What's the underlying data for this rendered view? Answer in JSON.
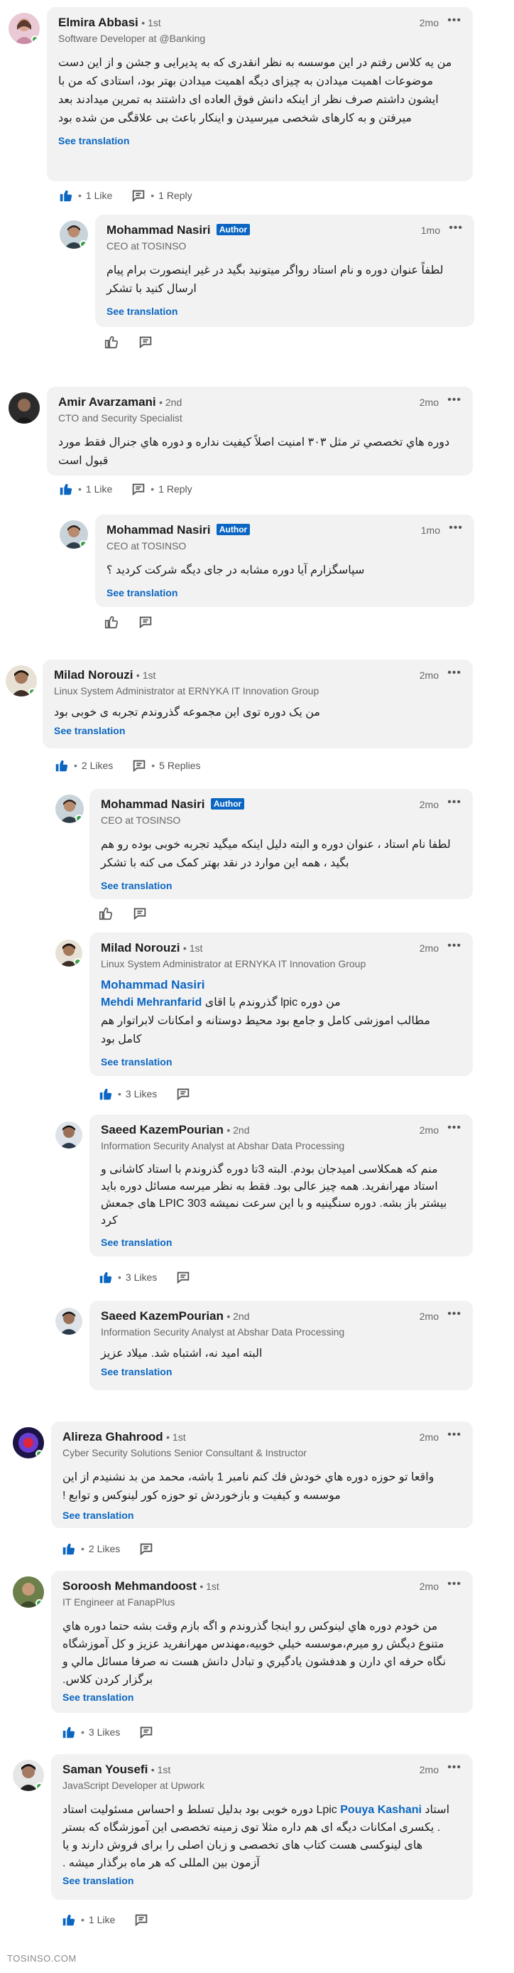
{
  "comments": [
    {
      "author": "Elmira Abbasi",
      "degree": "• 1st",
      "subtitle": "Software Developer at @Banking",
      "time": "2mo",
      "text": "من یه کلاس رفتم در این موسسه به نظر انقدری که به پدیرایی و جشن و از این دست موضوعات اهمیت میدادن به چیزای دیگه اهمیت میدادن بهتر بود، استادی که من با ایشون داشتم صرف نظر از اینکه دانش فوق العاده ای داشتند به تمرین میدادند بعد میرفتن و به کارهای شخصی میرسیدن و اینکار باعث بی علاقگی من شده بود",
      "see_translation": "See translation",
      "likes": "1 Like",
      "replies": "1 Reply"
    },
    {
      "author": "Mohammad Nasiri",
      "badge": "Author",
      "subtitle": "CEO at TOSINSO",
      "time": "1mo",
      "text": "لطفاً عنوان دوره و نام استاد رواگر میتونید بگید در غیر اینصورت برام پیام ارسال کنید با تشکر",
      "see_translation": "See translation"
    },
    {
      "author": "Amir Avarzamani",
      "degree": "• 2nd",
      "subtitle": "CTO and Security Specialist",
      "time": "2mo",
      "text": "دوره هاي تخصصي تر مثل ۳۰۳ امنیت اصلاً کیفیت نداره و دوره هاي جنرال فقط مورد قبول است",
      "likes": "1 Like",
      "replies": "1 Reply"
    },
    {
      "author": "Mohammad Nasiri",
      "badge": "Author",
      "subtitle": "CEO at TOSINSO",
      "time": "1mo",
      "text": "سپاسگزارم آیا دوره مشابه در جای دیگه شرکت کردید ؟",
      "see_translation": "See translation"
    },
    {
      "author": "Milad Norouzi",
      "degree": "• 1st",
      "subtitle": "Linux System Administrator at ERNYKA IT Innovation Group",
      "time": "2mo",
      "text": "من یک دوره توی این مجموعه گذروندم تجربه ی خوبی بود",
      "see_translation": "See translation",
      "likes": "2 Likes",
      "replies": "5 Replies"
    },
    {
      "author": "Mohammad Nasiri",
      "badge": "Author",
      "subtitle": "CEO at TOSINSO",
      "time": "2mo",
      "text": "لطفا نام استاد ، عنوان دوره و البته دلیل اینکه میگید تجربه خوبی بوده رو هم بگید ، همه این موارد در نقد بهتر کمک می کنه با تشکر",
      "see_translation": "See translation"
    },
    {
      "author": "Milad Norouzi",
      "degree": "• 1st",
      "subtitle": "Linux System Administrator at ERNYKA IT Innovation Group",
      "time": "2mo",
      "mention": "Mohammad Nasiri",
      "text_a": "من دوره lpic گذروندم با اقای",
      "mention2": "Mehdi Mehranfarid",
      "text_b": "مطالب اموزشی کامل و جامع بود محیط دوستانه و امکانات لابراتوار هم کامل بود",
      "see_translation": "See translation",
      "likes": "3 Likes"
    },
    {
      "author": "Saeed KazemPourian",
      "degree": "• 2nd",
      "subtitle": "Information Security Analyst at Abshar Data Processing",
      "time": "2mo",
      "text": "منم که همکلاسی امیدجان بودم. البته 3تا دوره گذروندم با استاد کاشانی و استاد مهرانفرید. همه چیز عالی بود. فقط به نظر میرسه مسائل دوره باید بیشتر باز بشه. دوره سنگینیه و با این سرعت نمیشه LPIC 303 های جمعش کرد",
      "see_translation": "See translation",
      "likes": "3 Likes"
    },
    {
      "author": "Saeed KazemPourian",
      "degree": "• 2nd",
      "subtitle": "Information Security Analyst at Abshar Data Processing",
      "time": "2mo",
      "text": "البته امید نه، اشتباه شد. میلاد عزیز",
      "see_translation": "See translation"
    },
    {
      "author": "Alireza Ghahrood",
      "degree": "• 1st",
      "subtitle": "Cyber Security Solutions Senior Consultant & Instructor",
      "time": "2mo",
      "text": "واقعا تو حوزه دوره هاي خودش فك كنم نامبر 1 باشه، محمد من بد نشنيدم از اين موسسه و كيفيت و بازخوردش تو حوزه كور لينوكس و توابع !",
      "see_translation": "See translation",
      "likes": "2 Likes"
    },
    {
      "author": "Soroosh Mehmandoost",
      "degree": "• 1st",
      "subtitle": "IT Engineer at FanapPlus",
      "time": "2mo",
      "text": "من خودم دوره هاي لينوكس رو اينجا گذروندم و اگه بازم وقت بشه حتما دوره هاي متنوع ديگش رو ميرم،موسسه خيلي خوبيه،مهندس مهرانفريد عزيز و كل آموزشگاه نگاه حرفه اي دارن و هدفشون يادگيري و تبادل دانش هست نه صرفا مسائل مالي و برگزار كردن كلاس.",
      "see_translation": "See translation",
      "likes": "3 Likes"
    },
    {
      "author": "Saman Yousefi",
      "degree": "• 1st",
      "subtitle": "JavaScript Developer at Upwork",
      "time": "2mo",
      "text_a": "دوره خوبی بود بدلیل تسلط و احساس",
      "mention": "Pouya Kashani",
      "text_mid": "استاد Lpic",
      "text_b": "مسئولیت استاد . یکسری امکانات دیگه ای هم داره مثلا توی زمینه تخصصی این آموزشگاه که بستر های لینوکسی هست کتاب های تخصصی و زبان اصلی را برای فروش دارند و یا آزمون بین المللی که هر ماه برگذار میشه .",
      "see_translation": "See translation",
      "likes": "1 Like"
    }
  ],
  "footer": "TOSINSO.COM"
}
